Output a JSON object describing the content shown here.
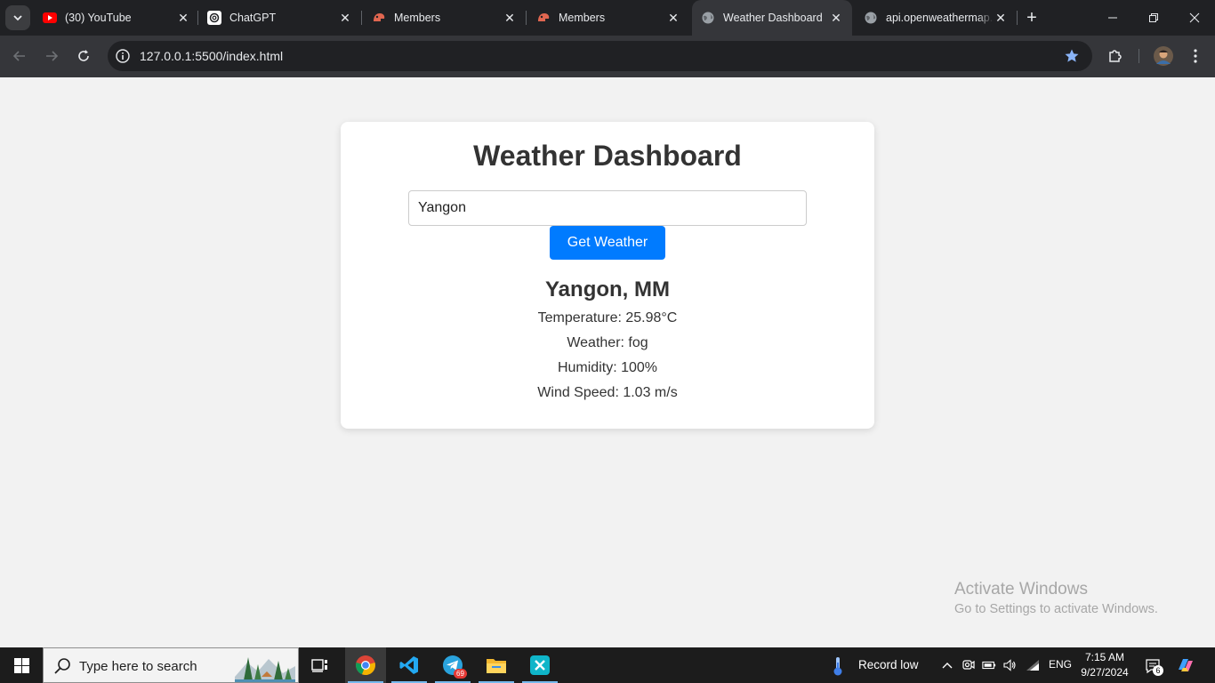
{
  "browser": {
    "tabs": [
      {
        "title": "(30) YouTube",
        "icon": "youtube-icon"
      },
      {
        "title": "ChatGPT",
        "icon": "chatgpt-icon"
      },
      {
        "title": "Members",
        "icon": "members-icon"
      },
      {
        "title": "Members",
        "icon": "members-icon"
      },
      {
        "title": "Weather Dashboard",
        "icon": "globe-icon",
        "active": true
      },
      {
        "title": "api.openweathermap.",
        "icon": "globe-icon"
      }
    ],
    "url": "127.0.0.1:5500/index.html"
  },
  "app": {
    "title": "Weather Dashboard",
    "input_value": "Yangon",
    "button_label": "Get Weather",
    "accent_color": "#007bff"
  },
  "result": {
    "city": "Yangon, MM",
    "temperature": "Temperature: 25.98°C",
    "weather": "Weather: fog",
    "humidity": "Humidity: 100%",
    "wind": "Wind Speed: 1.03 m/s"
  },
  "watermark": {
    "title": "Activate Windows",
    "subtitle": "Go to Settings to activate Windows."
  },
  "taskbar": {
    "search_placeholder": "Type here to search",
    "telegram_badge": "69",
    "weather_text": "Record low",
    "language": "ENG",
    "time": "7:15 AM",
    "date": "9/27/2024",
    "notification_count": "6"
  }
}
